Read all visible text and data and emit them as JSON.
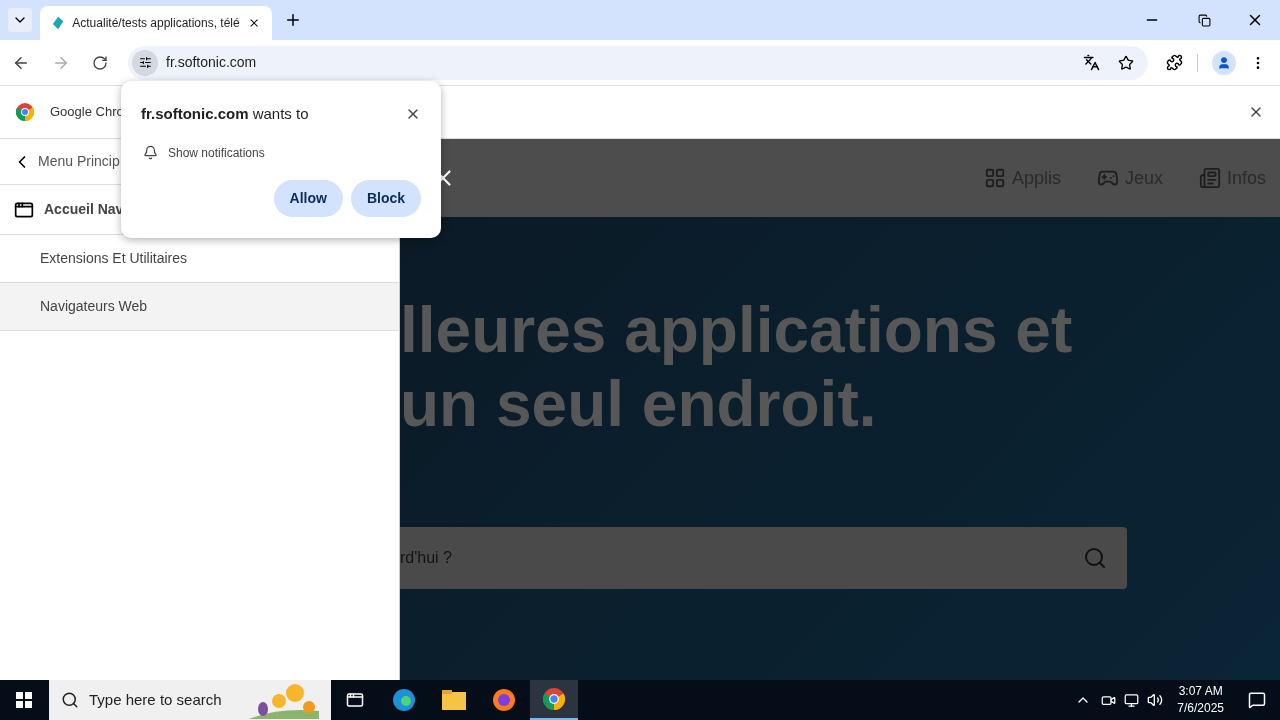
{
  "browser": {
    "tabs": [
      {
        "title": "Actualité/tests applications, télé",
        "selected": true
      }
    ],
    "url": "fr.softonic.com"
  },
  "infobar": {
    "text": "Google Chro"
  },
  "permission_popup": {
    "site": "fr.softonic.com",
    "title_rest": " wants to",
    "permission": "Show notifications",
    "buttons": [
      "Allow",
      "Block"
    ]
  },
  "drawer": {
    "back": "Menu Princip",
    "heading": "Accueil Nav",
    "items": [
      {
        "label": "Extensions Et Utilitaires",
        "selected": false
      },
      {
        "label": "Navigateurs Web",
        "selected": true
      }
    ]
  },
  "site_nav": [
    "Applis",
    "Jeux",
    "Infos"
  ],
  "hero": {
    "lines": [
      "lleures applications et",
      "un seul endroit."
    ],
    "search_placeholder": "rd'hui ?"
  },
  "taskbar": {
    "search_placeholder": "Type here to search",
    "time": "3:07 AM",
    "date": "7/6/2025"
  }
}
